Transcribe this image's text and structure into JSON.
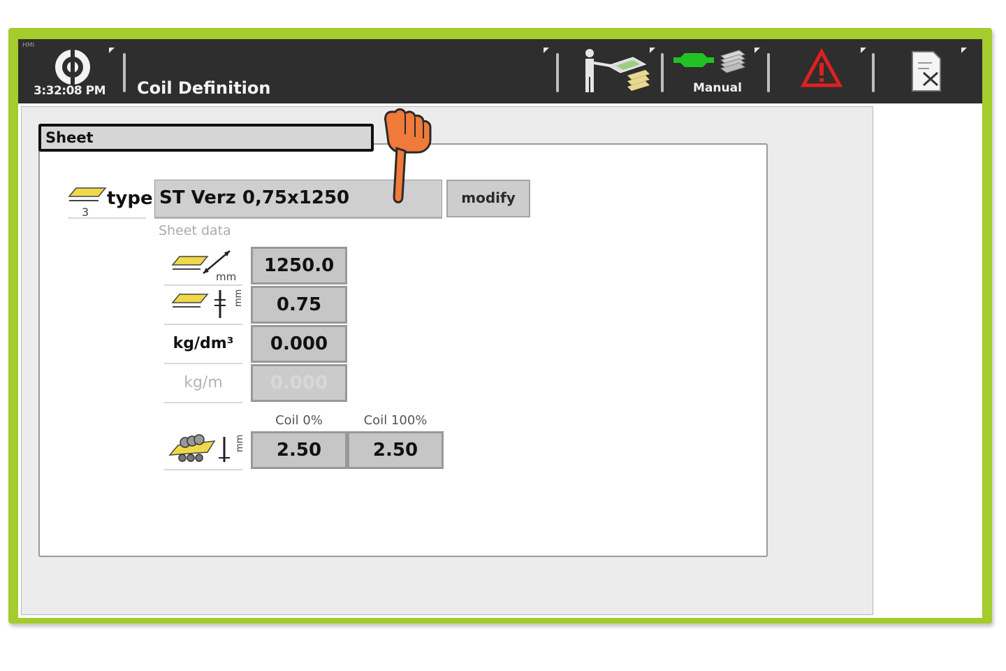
{
  "topbar": {
    "system_label": "HMI",
    "time": "3:32:08 PM",
    "title": "Coil Definition",
    "manual_label": "Manual"
  },
  "group": {
    "tab_label": "Sheet"
  },
  "type_row": {
    "icon_number": "3",
    "label": "type",
    "value": "ST Verz 0,75x1250",
    "modify_label": "modify"
  },
  "sheet_data": {
    "label": "Sheet data",
    "rows": [
      {
        "icon": "sheet-width-icon",
        "unit": "mm",
        "value": "1250.0"
      },
      {
        "icon": "sheet-thickness-icon",
        "unit": "mm",
        "value": "0.75"
      },
      {
        "icon": "",
        "unit": "kg/dm³",
        "value": "0.000"
      },
      {
        "icon": "",
        "unit": "kg/m",
        "value": "0.000",
        "disabled": true
      }
    ]
  },
  "coil": {
    "col_0": "Coil 0%",
    "col_100": "Coil 100%",
    "unit": "mm",
    "value_0": "2.50",
    "value_100": "2.50"
  },
  "colors": {
    "frame": "#a4cc2c",
    "topbar": "#2e2e2e",
    "manual_green": "#22c222",
    "warning_red": "#e02020",
    "pointer_orange": "#f07a3a"
  }
}
